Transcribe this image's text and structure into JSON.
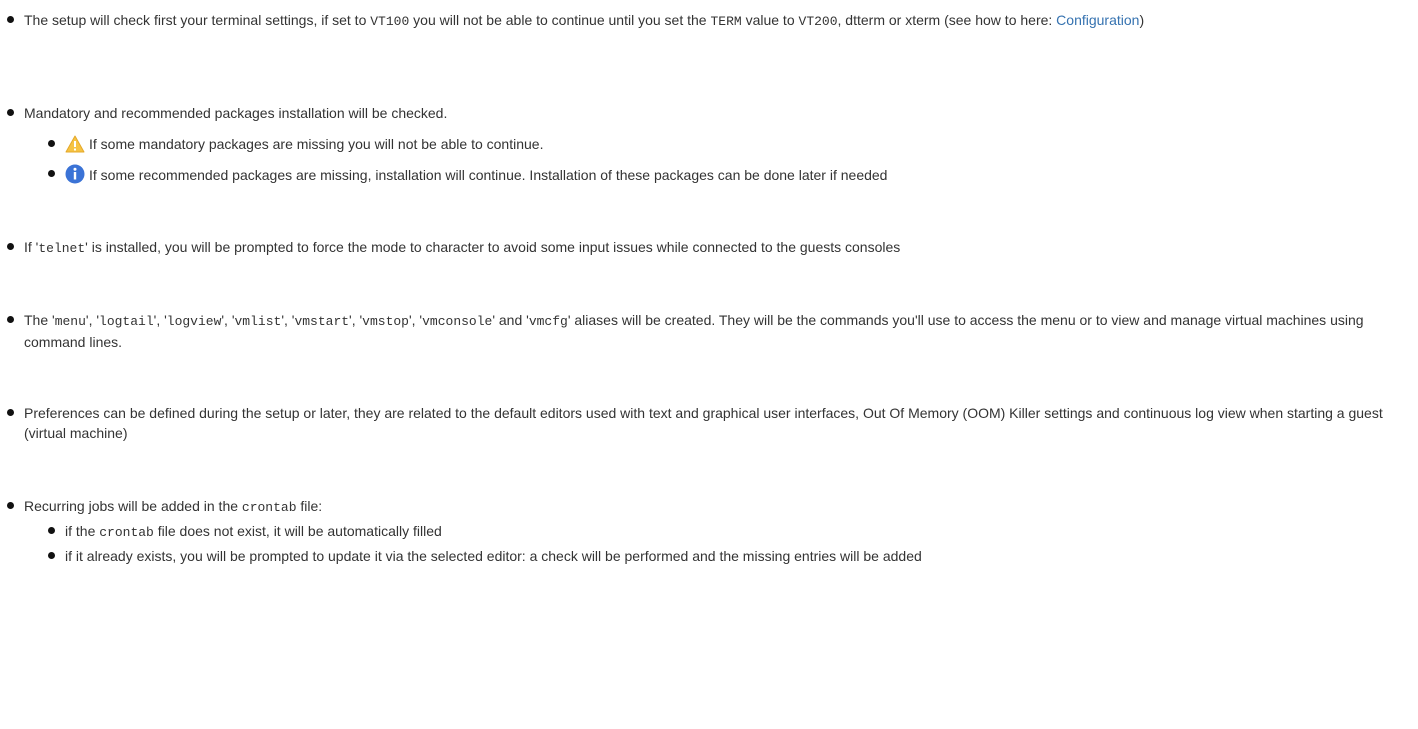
{
  "items": [
    {
      "p1": "The setup will check first your terminal settings, if set to ",
      "c1": "VT100",
      "p2": " you will not be able to continue until you set the ",
      "c2": "TERM",
      "p3": " value to ",
      "c3": "VT200",
      "p4": ", dtterm or xterm (see how to here: ",
      "link": "Configuration",
      "p5": ")"
    },
    {
      "text": "Mandatory and recommended packages installation will be checked.",
      "sub": [
        {
          "icon": "warning-icon",
          "text": "If some mandatory packages are missing you will not be able to continue."
        },
        {
          "icon": "info-icon",
          "text": "If some recommended packages are missing, installation will continue. Installation of these packages can be done later if needed"
        }
      ]
    },
    {
      "p1": "If '",
      "c1": "telnet",
      "p2": "' is installed, you will be prompted to force the mode to character to avoid some input issues while connected to the guests consoles"
    },
    {
      "p0": "The '",
      "aliases": [
        "menu",
        "logtail",
        "logview",
        "vmlist",
        "vmstart",
        "vmstop",
        "vmconsole",
        "vmcfg"
      ],
      "seps": [
        "', '",
        "', '",
        "', '",
        "', '",
        "', '",
        "', '",
        "' and '"
      ],
      "tail": "' aliases will be created. They will be the commands you'll use to access the menu or to view and manage virtual machines using command lines."
    },
    {
      "text": "Preferences can be defined during the setup or later, they are related to the default editors used with text and graphical user interfaces, Out Of Memory (OOM) Killer settings and continuous log view when starting a guest (virtual machine)"
    },
    {
      "p1": "Recurring jobs will be added in the ",
      "c1": "crontab",
      "p2": " file:",
      "sub": [
        {
          "p1": "if the ",
          "c1": "crontab",
          "p2": " file does not exist, it will be automatically filled"
        },
        {
          "text": "if it already exists, you will be prompted to update it via the selected editor: a check will be performed and the missing entries will be added"
        }
      ]
    }
  ],
  "colors": {
    "text": "#333333",
    "link": "#3572b0",
    "warning": "#f6c342",
    "info": "#3b73d6"
  }
}
